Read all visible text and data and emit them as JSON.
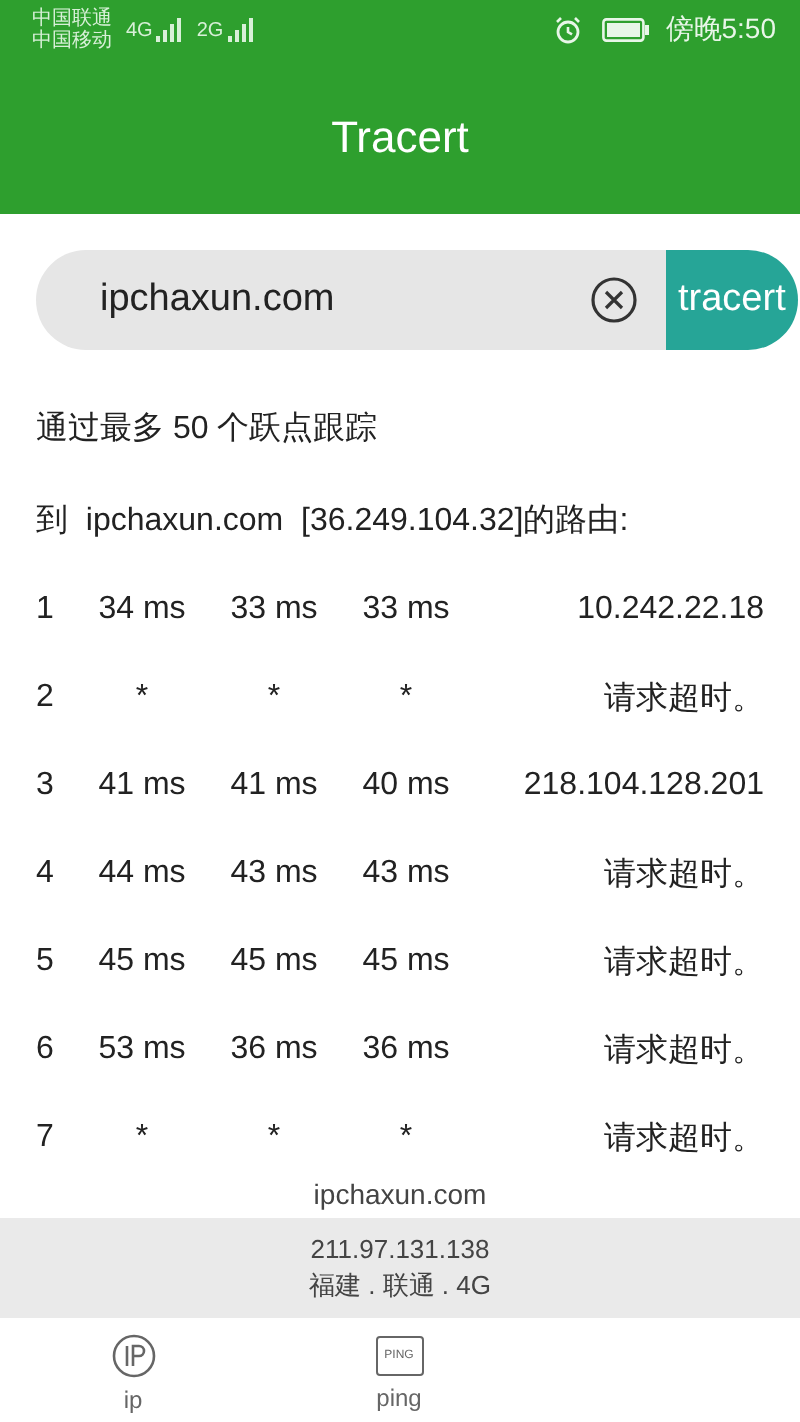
{
  "status_bar": {
    "carriers": [
      "中国联通",
      "中国移动"
    ],
    "networks": [
      "4G",
      "2G"
    ],
    "time": "傍晚5:50"
  },
  "header": {
    "title": "Tracert"
  },
  "search": {
    "value": "ipchaxun.com",
    "button": "tracert"
  },
  "output": {
    "lines": [
      "通过最多 50 个跃点跟踪",
      "到  ipchaxun.com  [36.249.104.32]的路由:"
    ],
    "hops": [
      {
        "index": "1",
        "times": [
          "34 ms",
          "33 ms",
          "33 ms"
        ],
        "result": "10.242.22.18"
      },
      {
        "index": "2",
        "times": [
          "*",
          "*",
          "*"
        ],
        "result": "请求超时。"
      },
      {
        "index": "3",
        "times": [
          "41 ms",
          "41 ms",
          "40 ms"
        ],
        "result": "218.104.128.201"
      },
      {
        "index": "4",
        "times": [
          "44 ms",
          "43 ms",
          "43 ms"
        ],
        "result": "请求超时。"
      },
      {
        "index": "5",
        "times": [
          "45 ms",
          "45 ms",
          "45 ms"
        ],
        "result": "请求超时。"
      },
      {
        "index": "6",
        "times": [
          "53 ms",
          "36 ms",
          "36 ms"
        ],
        "result": "请求超时。"
      },
      {
        "index": "7",
        "times": [
          "*",
          "*",
          "*"
        ],
        "result": "请求超时。"
      }
    ]
  },
  "footer": {
    "site": "ipchaxun.com",
    "ip": "211.97.131.138",
    "location": "福建 . 联通 . 4G"
  },
  "nav": [
    {
      "kind": "ip",
      "label": "ip",
      "selected": false
    },
    {
      "kind": "ping",
      "label": "ping",
      "icon_text": "PING",
      "selected": false
    }
  ]
}
